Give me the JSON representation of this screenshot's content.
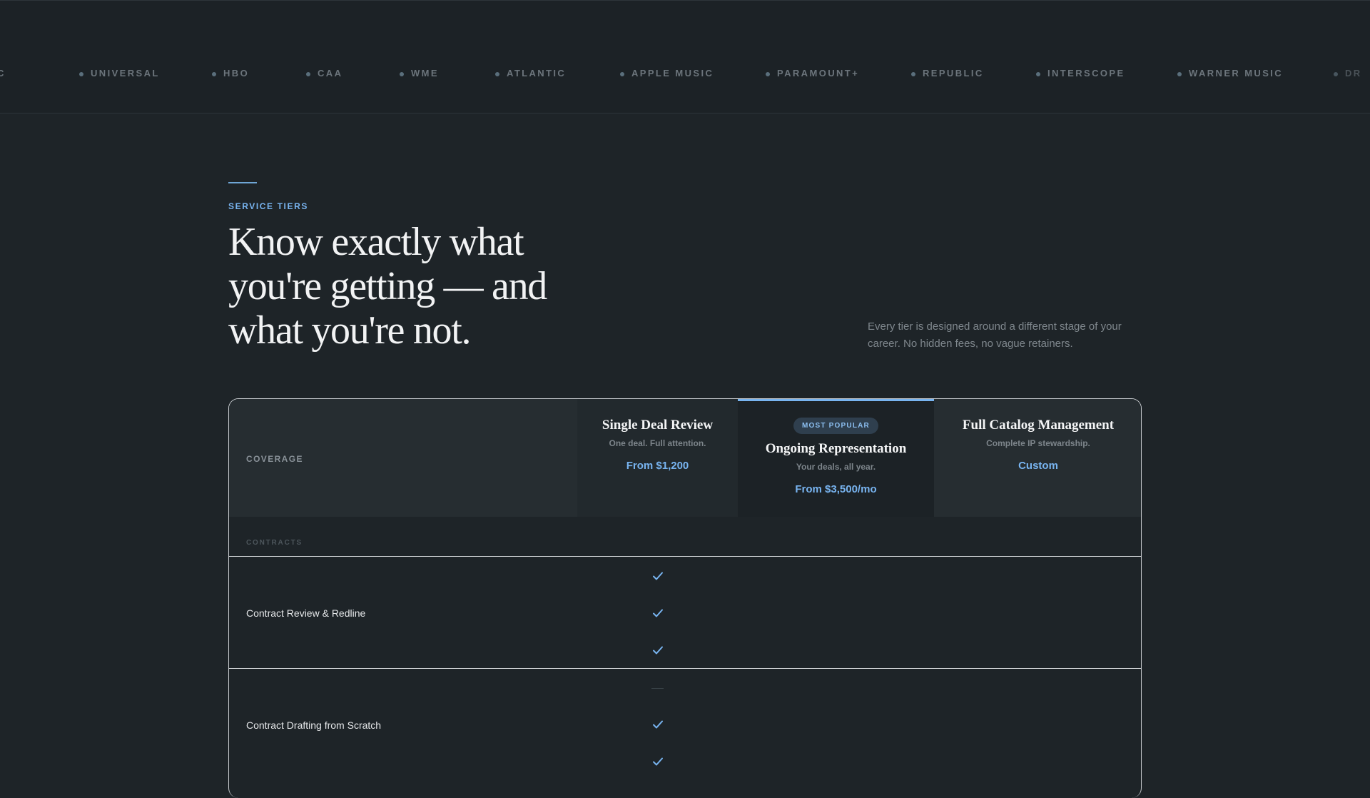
{
  "marquee": {
    "items": [
      {
        "label": "C"
      },
      {
        "label": "UNIVERSAL"
      },
      {
        "label": "HBO"
      },
      {
        "label": "CAA"
      },
      {
        "label": "WME"
      },
      {
        "label": "ATLANTIC"
      },
      {
        "label": "APPLE MUSIC"
      },
      {
        "label": "PARAMOUNT+"
      },
      {
        "label": "REPUBLIC"
      },
      {
        "label": "INTERSCOPE"
      },
      {
        "label": "WARNER MUSIC"
      },
      {
        "label": "DR"
      }
    ]
  },
  "section": {
    "eyebrow": "SERVICE TIERS",
    "headline": "Know exactly what you're getting — and what you're not.",
    "intro": "Every tier is designed around a different stage of your career. No hidden fees, no vague retainers."
  },
  "table": {
    "coverage_label": "COVERAGE",
    "tiers": [
      {
        "name": "Single Deal Review",
        "subtitle": "One deal. Full attention.",
        "price": "From $1,200"
      },
      {
        "badge": "MOST POPULAR",
        "name": "Ongoing Representation",
        "subtitle": "Your deals, all year.",
        "price": "From $3,500/mo"
      },
      {
        "name": "Full Catalog Management",
        "subtitle": "Complete IP stewardship.",
        "price": "Custom"
      }
    ],
    "section_label": "CONTRACTS",
    "rows": [
      {
        "label": "Contract Review & Redline",
        "marks": [
          "check",
          "check",
          "check"
        ]
      },
      {
        "label": "Contract Drafting from Scratch",
        "marks": [
          "dash",
          "check",
          "check"
        ]
      }
    ]
  },
  "colors": {
    "background": "#1e2428",
    "accent": "#78b4f0",
    "text": "#e6e8ea",
    "muted": "#7f878d"
  }
}
